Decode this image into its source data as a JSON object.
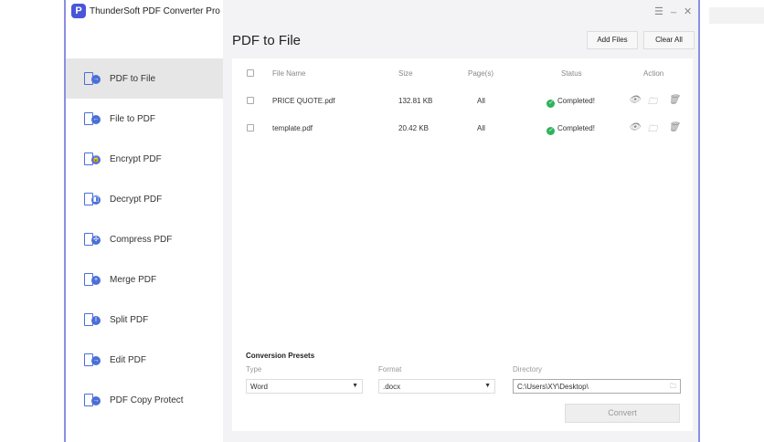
{
  "app": {
    "title": "ThunderSoft PDF Converter Pro",
    "logo": "P"
  },
  "window_controls": {
    "menu": "☰",
    "minimize": "_",
    "close": "✕"
  },
  "sidebar": {
    "items": [
      {
        "label": "PDF to File",
        "glyph": "→"
      },
      {
        "label": "File to PDF",
        "glyph": "←"
      },
      {
        "label": "Encrypt PDF",
        "glyph": "🔒"
      },
      {
        "label": "Decrypt PDF",
        "glyph": "◧"
      },
      {
        "label": "Compress PDF",
        "glyph": "✣"
      },
      {
        "label": "Merge PDF",
        "glyph": "+"
      },
      {
        "label": "Split PDF",
        "glyph": "I"
      },
      {
        "label": "Edit PDF",
        "glyph": "→"
      },
      {
        "label": "PDF Copy Protect",
        "glyph": "→"
      }
    ]
  },
  "main": {
    "title": "PDF to File",
    "add_files": "Add Files",
    "clear_all": "Clear All"
  },
  "table": {
    "headers": {
      "name": "File Name",
      "size": "Size",
      "pages": "Page(s)",
      "status": "Status",
      "action": "Action"
    },
    "rows": [
      {
        "name": "PRICE QUOTE.pdf",
        "size": "132.81 KB",
        "pages": "All",
        "status": "Completed!"
      },
      {
        "name": "template.pdf",
        "size": "20.42 KB",
        "pages": "All",
        "status": "Completed!"
      }
    ]
  },
  "presets": {
    "title": "Conversion Presets",
    "type_label": "Type",
    "type_value": "Word",
    "format_label": "Format",
    "format_value": ".docx",
    "dir_label": "Directory",
    "dir_value": "C:\\Users\\XY\\Desktop\\",
    "convert": "Convert"
  }
}
